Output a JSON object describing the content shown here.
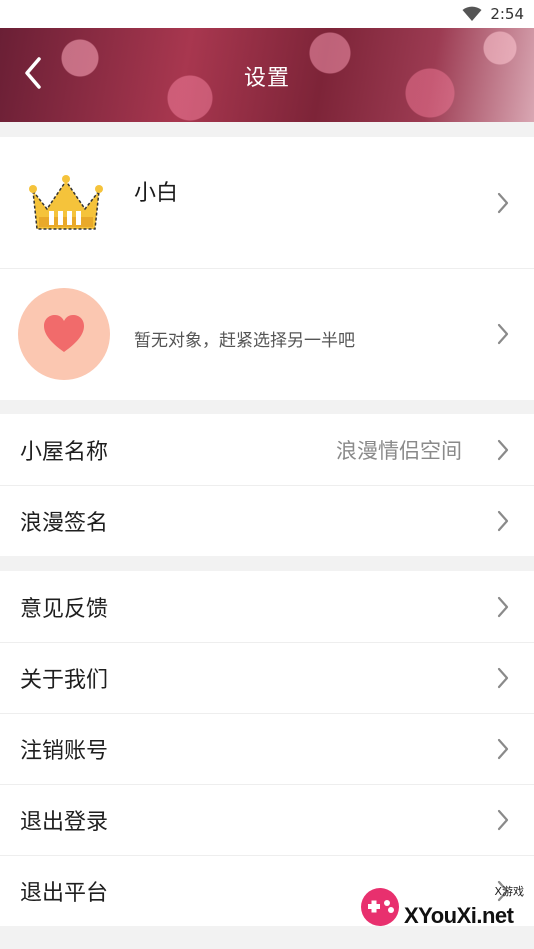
{
  "status_bar": {
    "time": "2:54"
  },
  "header": {
    "title": "设置"
  },
  "profile": {
    "name": "小白"
  },
  "partner": {
    "text": "暂无对象，赶紧选择另一半吧"
  },
  "settings_group_1": [
    {
      "label": "小屋名称",
      "value": "浪漫情侣空间"
    },
    {
      "label": "浪漫签名",
      "value": ""
    }
  ],
  "settings_group_2": [
    {
      "label": "意见反馈"
    },
    {
      "label": "关于我们"
    },
    {
      "label": "注销账号"
    },
    {
      "label": "退出登录"
    },
    {
      "label": "退出平台"
    }
  ],
  "watermark": {
    "site": "XYouXi.net",
    "tag": "X游戏"
  },
  "colors": {
    "heart_bg": "#fbc7b1",
    "heart": "#f16b6b",
    "crown": "#f5c33b"
  }
}
